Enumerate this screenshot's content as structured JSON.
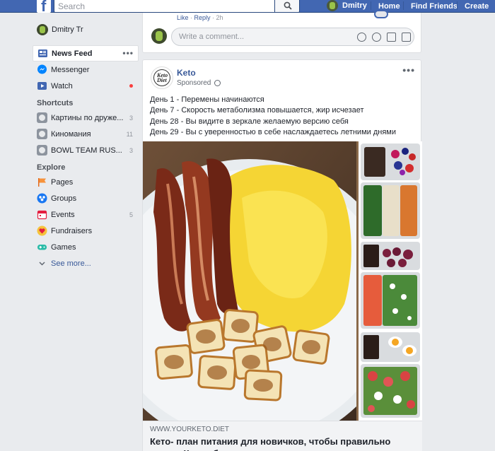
{
  "topbar": {
    "search_placeholder": "Search",
    "user_name": "Dmitry",
    "links": [
      "Home",
      "Find Friends",
      "Create"
    ]
  },
  "sidebar": {
    "profile_name": "Dmitry Tr",
    "main_items": [
      {
        "label": "News Feed",
        "icon": "news-feed-icon"
      },
      {
        "label": "Messenger",
        "icon": "messenger-icon"
      },
      {
        "label": "Watch",
        "icon": "watch-icon"
      }
    ],
    "shortcuts_heading": "Shortcuts",
    "shortcuts": [
      {
        "label": "Картины по друже...",
        "count": "3"
      },
      {
        "label": "Киномания",
        "count": "11"
      },
      {
        "label": "BOWL TEAM RUS...",
        "count": "3"
      }
    ],
    "explore_heading": "Explore",
    "explore": [
      {
        "label": "Pages",
        "count": ""
      },
      {
        "label": "Groups",
        "count": ""
      },
      {
        "label": "Events",
        "count": "5"
      },
      {
        "label": "Fundraisers",
        "count": ""
      },
      {
        "label": "Games",
        "count": ""
      }
    ],
    "see_more": "See more..."
  },
  "comment_box": {
    "prev_like": "Like",
    "prev_reply": "Reply",
    "prev_time": "2h",
    "placeholder": "Write a comment..."
  },
  "post": {
    "author": "Keto",
    "avatar_text": "Keto Diet",
    "sponsored": "Sponsored",
    "lines": [
      "День 1 - Перемены начинаются",
      "День 7 - Скорость метаболизма повышается, жир исчезает",
      "День 28 - Вы видите в зеркале желаемую версию себя",
      "День 29 - Вы с уверенностью в себе наслаждаетесь летними днями"
    ],
    "link_url": "WWW.YOURKETO.DIET",
    "link_title": "Кето- план питания для новичков, чтобы правильно начать Кето-образ жизни"
  },
  "colors": {
    "brand": "#4267b2",
    "link": "#385898",
    "notify": "#fa3e3e"
  }
}
